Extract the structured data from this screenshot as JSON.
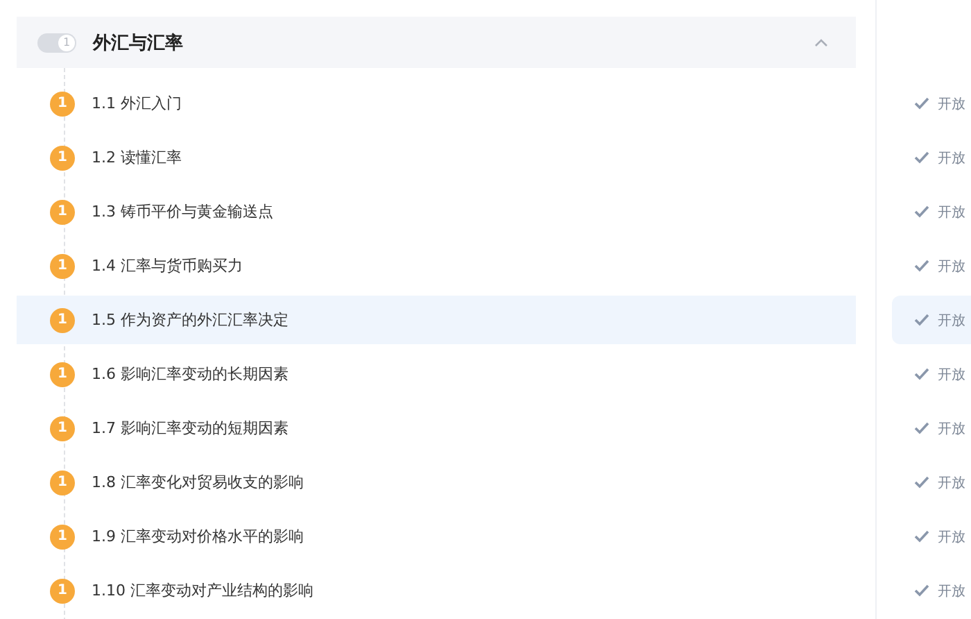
{
  "chapter": {
    "badge": "1",
    "title": "外汇与汇率",
    "expanded": true
  },
  "sections": [
    {
      "badge": "1",
      "title": "1.1 外汇入门",
      "status": "开放",
      "selected": false
    },
    {
      "badge": "1",
      "title": "1.2 读懂汇率",
      "status": "开放",
      "selected": false
    },
    {
      "badge": "1",
      "title": "1.3 铸币平价与黄金输送点",
      "status": "开放",
      "selected": false
    },
    {
      "badge": "1",
      "title": "1.4 汇率与货币购买力",
      "status": "开放",
      "selected": false
    },
    {
      "badge": "1",
      "title": "1.5 作为资产的外汇汇率决定",
      "status": "开放",
      "selected": true
    },
    {
      "badge": "1",
      "title": "1.6 影响汇率变动的长期因素",
      "status": "开放",
      "selected": false
    },
    {
      "badge": "1",
      "title": "1.7 影响汇率变动的短期因素",
      "status": "开放",
      "selected": false
    },
    {
      "badge": "1",
      "title": "1.8 汇率变化对贸易收支的影响",
      "status": "开放",
      "selected": false
    },
    {
      "badge": "1",
      "title": "1.9 汇率变动对价格水平的影响",
      "status": "开放",
      "selected": false
    },
    {
      "badge": "1",
      "title": "1.10 汇率变动对产业结构的影响",
      "status": "开放",
      "selected": false
    }
  ]
}
